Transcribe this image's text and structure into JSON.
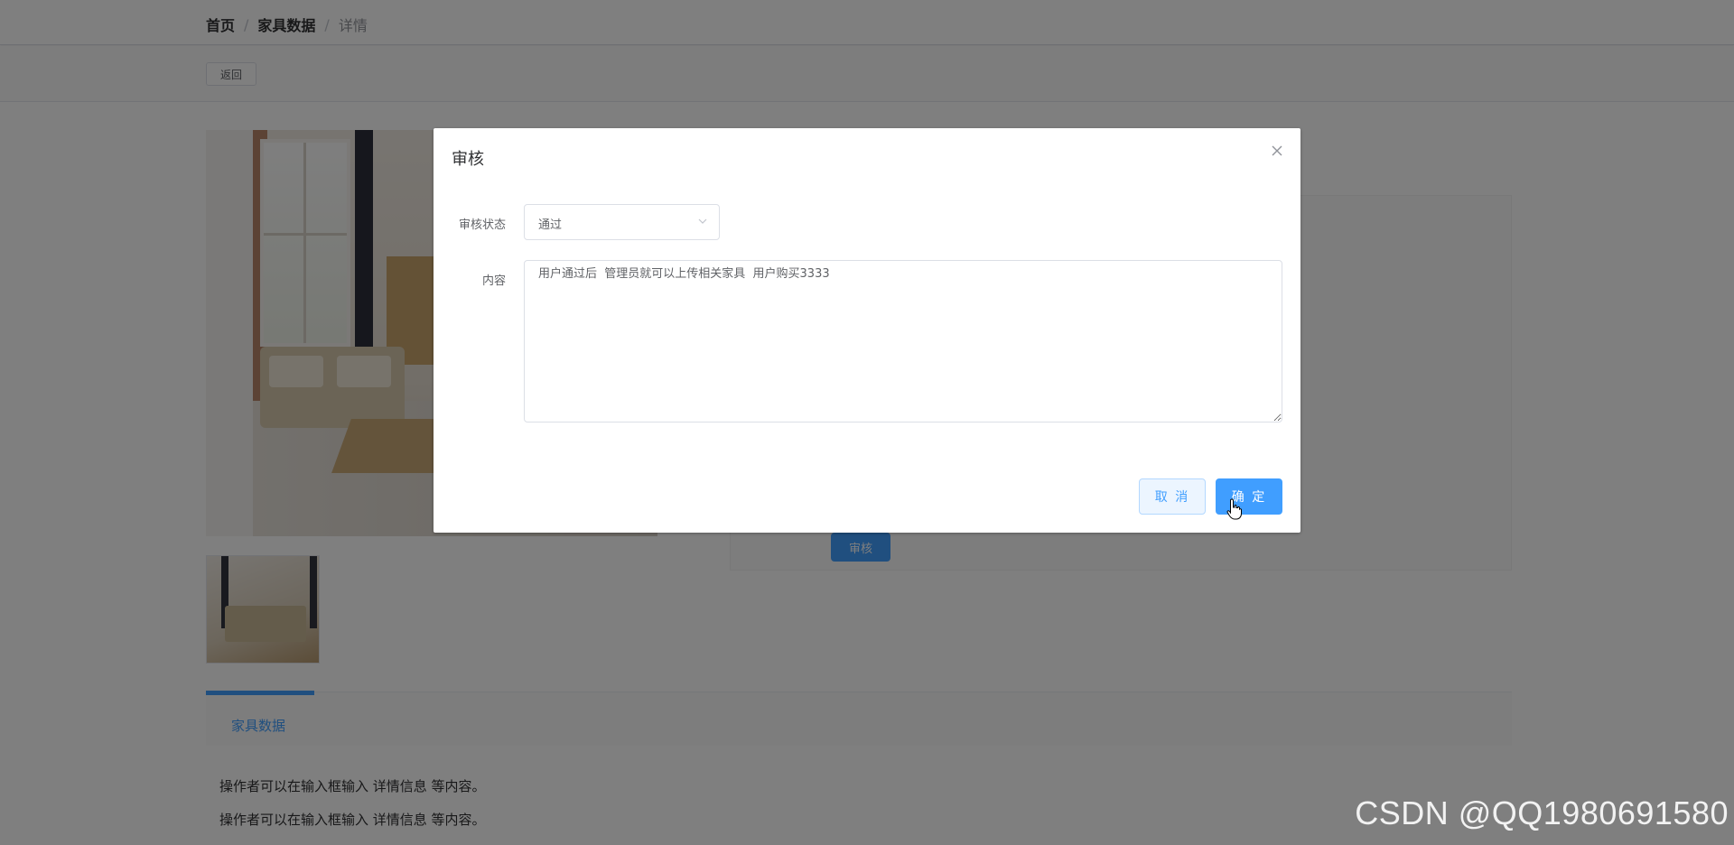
{
  "breadcrumb": {
    "home": "首页",
    "section": "家具数据",
    "current": "详情",
    "sep": "/"
  },
  "toolbar": {
    "back_label": "返回"
  },
  "page": {
    "audit_button_label": "审核"
  },
  "tabs": [
    {
      "label": "家具数据"
    }
  ],
  "content": {
    "lines": [
      "操作者可以在输入框输入  详情信息  等内容。",
      "操作者可以在输入框输入  详情信息  等内容。"
    ]
  },
  "dialog": {
    "title": "审核",
    "close_icon": "close-icon",
    "status_label": "审核状态",
    "status_value": "通过",
    "content_label": "内容",
    "content_value": "用户通过后  管理员就可以上传相关家具  用户购买3333",
    "cancel_label": "取 消",
    "ok_label": "确 定"
  },
  "watermark": "CSDN @QQ1980691580",
  "colors": {
    "primary": "#409eff",
    "overlay": "rgba(0,0,0,0.5)"
  }
}
